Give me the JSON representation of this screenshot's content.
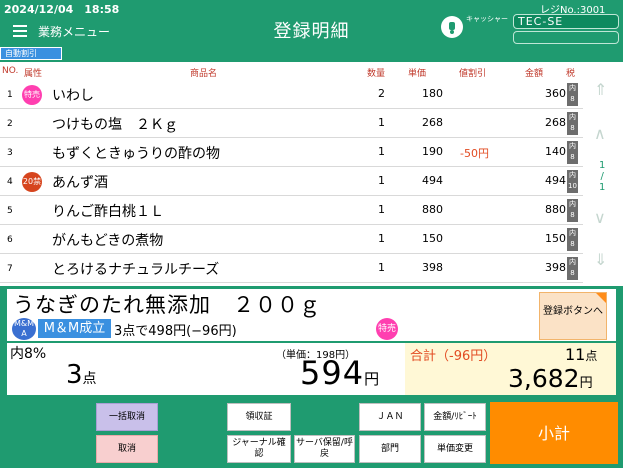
{
  "header": {
    "datetime": "2024/12/04　18:58",
    "menu_label": "業務メニュー",
    "title": "登録明細",
    "register_no": "レジNo.:3001",
    "logo_text": "キャッシャー",
    "cashier": "TEC-SE",
    "auto_discount": "自動割引"
  },
  "table": {
    "headers": {
      "no": "NO.",
      "attr": "属性",
      "name": "商品名",
      "qty": "数量",
      "price": "単価",
      "disc": "値割引",
      "amt": "金額",
      "tax": "税"
    },
    "rows": [
      {
        "no": "1",
        "attr": "特売",
        "name": "いわし",
        "qty": "2",
        "price": "180",
        "disc": "",
        "amt": "360",
        "tax": "内8"
      },
      {
        "no": "2",
        "attr": "",
        "name": "つけもの塩　２Ｋｇ",
        "qty": "1",
        "price": "268",
        "disc": "",
        "amt": "268",
        "tax": "内8"
      },
      {
        "no": "3",
        "attr": "",
        "name": "もずくときゅうりの酢の物",
        "qty": "1",
        "price": "190",
        "disc": "-50円",
        "amt": "140",
        "tax": "内8"
      },
      {
        "no": "4",
        "attr": "20禁",
        "name": "あんず酒",
        "qty": "1",
        "price": "494",
        "disc": "",
        "amt": "494",
        "tax": "内10"
      },
      {
        "no": "5",
        "attr": "",
        "name": "りんご酢白桃１Ｌ",
        "qty": "1",
        "price": "880",
        "disc": "",
        "amt": "880",
        "tax": "内8"
      },
      {
        "no": "6",
        "attr": "",
        "name": "がんもどきの煮物",
        "qty": "1",
        "price": "150",
        "disc": "",
        "amt": "150",
        "tax": "内8"
      },
      {
        "no": "7",
        "attr": "",
        "name": "とろけるナチュラルチーズ",
        "qty": "1",
        "price": "398",
        "disc": "",
        "amt": "398",
        "tax": "内8"
      }
    ],
    "page": "1",
    "page_sep": "/",
    "page_total": "1"
  },
  "detail": {
    "product_name": "うなぎのたれ無添加　２００ｇ",
    "mm_badge": "M&M A",
    "mm_label": "M＆M成立",
    "mm_desc": "3点で498円(−96円)",
    "attr": "特売",
    "register_button": "登録ボタンへ"
  },
  "summary": {
    "tax_label": "内8%",
    "tax_count": "3",
    "tax_count_unit": "点",
    "unit_price": "（単価：198円）",
    "sub_amount": "594",
    "sub_amount_unit": "円",
    "total_label": "合計（-96円）",
    "total_count": "11",
    "total_count_unit": "点",
    "total_amount": "3,682",
    "total_amount_unit": "円"
  },
  "buttons": {
    "bulk_cancel": "一括取消",
    "cancel": "取消",
    "receipt": "領収証",
    "journal": "ジャーナル確認",
    "server_hold": "サーバ保留/呼戻",
    "jan": "ＪＡＮ",
    "amount_rebate": "金額/ﾘﾋﾞｰﾄ",
    "department": "部門",
    "price_change": "単価変更",
    "subtotal": "小計"
  },
  "colors": {
    "header": "#1f9b70",
    "accent_orange": "#ff8c00",
    "sale_pink": "#ff3fb0",
    "age_red": "#d6451e",
    "discount_red": "#e24b22"
  }
}
